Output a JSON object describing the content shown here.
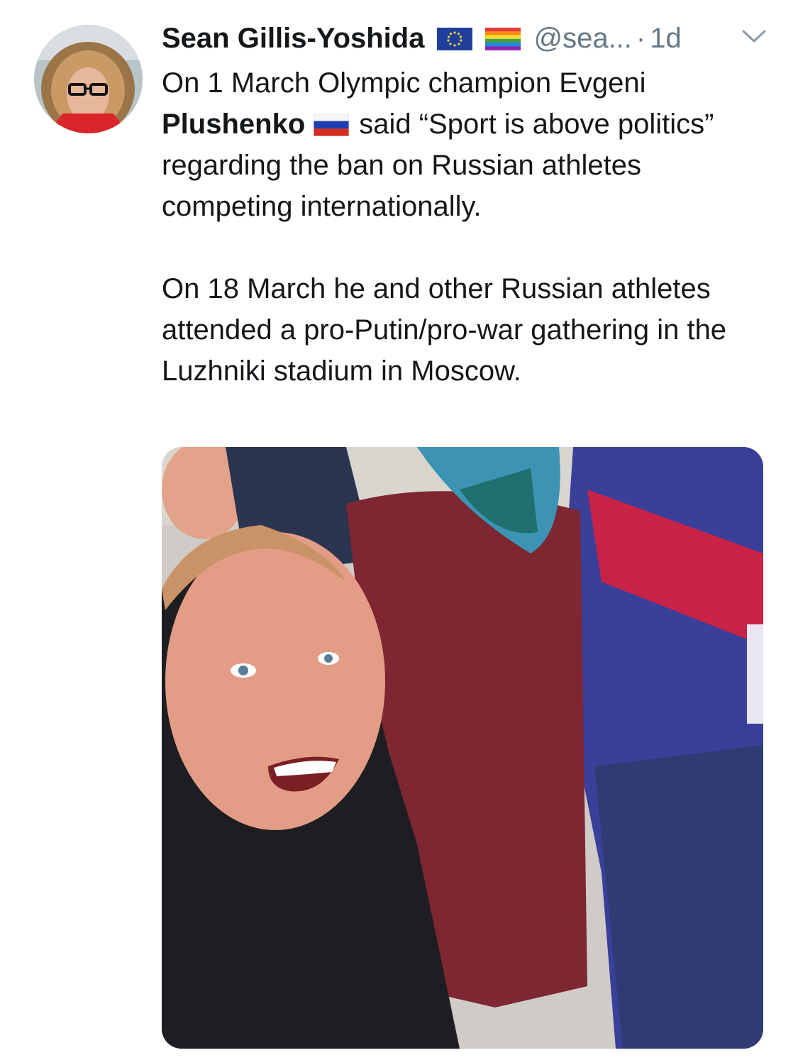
{
  "tweet": {
    "author_name": "Sean Gillis-Yoshida",
    "author_flags": [
      "eu-flag-icon",
      "rainbow-flag-icon"
    ],
    "handle": "@sea...",
    "separator": "·",
    "timestamp": "1d",
    "menu_icon": "chevron-down-icon",
    "paragraph1_part1": "On 1 March Olympic champion Evgeni ",
    "paragraph1_bold": "Plushenko",
    "paragraph1_flag": "russia-flag-icon",
    "paragraph1_part2": "said “Sport is above politics” regarding the ban on Russian athletes competing internationally.",
    "paragraph2": "On 18 March he and other Russian athletes attended a pro-Putin/pro-war gathering in the Luzhniki stadium in Moscow.",
    "media": "photo"
  },
  "colors": {
    "text": "#14171a",
    "secondary": "#657786",
    "background": "#ffffff"
  }
}
